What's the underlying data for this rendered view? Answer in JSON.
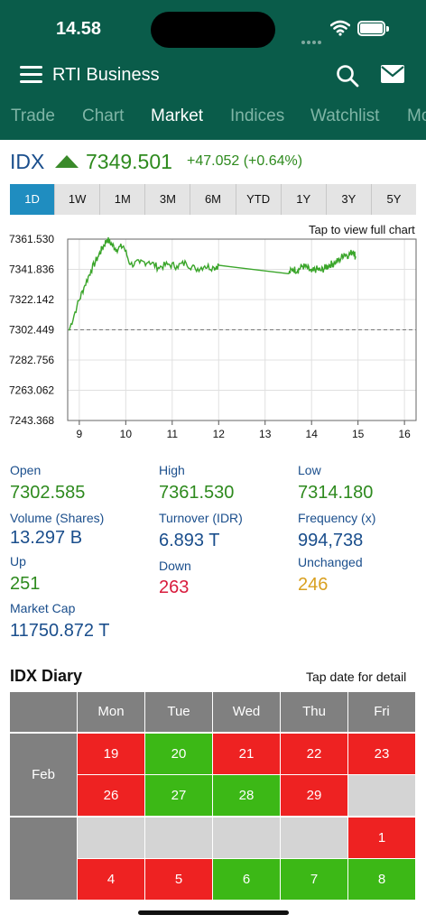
{
  "status_bar": {
    "time": "14.58"
  },
  "header": {
    "title": "RTI Business",
    "tabs": [
      {
        "label": "Trade",
        "active": false
      },
      {
        "label": "Chart",
        "active": false
      },
      {
        "label": "Market",
        "active": true
      },
      {
        "label": "Indices",
        "active": false
      },
      {
        "label": "Watchlist",
        "active": false
      },
      {
        "label": "Mo",
        "active": false
      }
    ]
  },
  "quote": {
    "symbol": "IDX",
    "price": "7349.501",
    "change": "+47.052 (+0.64%)",
    "direction": "up"
  },
  "ranges": [
    {
      "label": "1D",
      "active": true
    },
    {
      "label": "1W",
      "active": false
    },
    {
      "label": "1M",
      "active": false
    },
    {
      "label": "3M",
      "active": false
    },
    {
      "label": "6M",
      "active": false
    },
    {
      "label": "YTD",
      "active": false
    },
    {
      "label": "1Y",
      "active": false
    },
    {
      "label": "3Y",
      "active": false
    },
    {
      "label": "5Y",
      "active": false
    }
  ],
  "chart_hint": "Tap to view full chart",
  "chart_data": {
    "type": "line",
    "y_ticks": [
      "7361.530",
      "7341.836",
      "7322.142",
      "7302.449",
      "7282.756",
      "7263.062",
      "7243.368"
    ],
    "x_ticks": [
      "9",
      "10",
      "11",
      "12",
      "13",
      "14",
      "15",
      "16"
    ],
    "ylim": [
      7243.368,
      7361.53
    ],
    "xlim": [
      8.75,
      16.25
    ],
    "reference_line": 7302.449,
    "series": [
      {
        "x": [
          8.78,
          8.95,
          9.1,
          9.25,
          9.4,
          9.5,
          9.6,
          9.7,
          9.8,
          9.95,
          10.1,
          10.3,
          10.5,
          10.7,
          10.9,
          11.1,
          11.3,
          11.5,
          11.7,
          11.9,
          12.0,
          13.5,
          13.6,
          13.7,
          13.8,
          13.9,
          14.0,
          14.1,
          14.2,
          14.3,
          14.4,
          14.5,
          14.6,
          14.7,
          14.8,
          14.9,
          14.95
        ],
        "y": [
          7302.0,
          7318.0,
          7330.0,
          7341.0,
          7350.0,
          7356.0,
          7361.5,
          7358.0,
          7355.0,
          7357.0,
          7345.0,
          7346.0,
          7347.0,
          7343.0,
          7345.0,
          7344.0,
          7346.0,
          7342.0,
          7344.0,
          7343.0,
          7344.5,
          7339.0,
          7342.0,
          7341.0,
          7344.0,
          7343.0,
          7340.0,
          7342.0,
          7341.0,
          7343.0,
          7345.0,
          7346.0,
          7348.0,
          7352.0,
          7351.0,
          7354.0,
          7349.5
        ]
      }
    ],
    "line_color": "#3aa52a"
  },
  "stats": {
    "open_label": "Open",
    "open": "7302.585",
    "high_label": "High",
    "high": "7361.530",
    "low_label": "Low",
    "low": "7314.180",
    "volume_label": "Volume (Shares)",
    "volume": "13.297 B",
    "turnover_label": "Turnover (IDR)",
    "turnover": "6.893 T",
    "frequency_label": "Frequency (x)",
    "frequency": "994,738",
    "up_label": "Up",
    "up": "251",
    "down_label": "Down",
    "down": "263",
    "unchanged_label": "Unchanged",
    "unchanged": "246",
    "marketcap_label": "Market Cap",
    "marketcap": "11750.872 T"
  },
  "diary": {
    "title": "IDX Diary",
    "hint": "Tap date for detail",
    "days": [
      "Mon",
      "Tue",
      "Wed",
      "Thu",
      "Fri"
    ],
    "weeks": [
      {
        "label": "Feb",
        "rows": [
          [
            {
              "d": "19",
              "s": "red"
            },
            {
              "d": "20",
              "s": "green"
            },
            {
              "d": "21",
              "s": "red"
            },
            {
              "d": "22",
              "s": "red"
            },
            {
              "d": "23",
              "s": "red"
            }
          ],
          [
            {
              "d": "26",
              "s": "red"
            },
            {
              "d": "27",
              "s": "green"
            },
            {
              "d": "28",
              "s": "green"
            },
            {
              "d": "29",
              "s": "red"
            },
            {
              "d": "",
              "s": "grey"
            }
          ]
        ]
      },
      {
        "label": "",
        "rows": [
          [
            {
              "d": "",
              "s": "grey"
            },
            {
              "d": "",
              "s": "grey"
            },
            {
              "d": "",
              "s": "grey"
            },
            {
              "d": "",
              "s": "grey"
            },
            {
              "d": "1",
              "s": "red"
            }
          ],
          [
            {
              "d": "4",
              "s": "red"
            },
            {
              "d": "5",
              "s": "red"
            },
            {
              "d": "6",
              "s": "green"
            },
            {
              "d": "7",
              "s": "green"
            },
            {
              "d": "8",
              "s": "green"
            }
          ]
        ]
      }
    ]
  }
}
